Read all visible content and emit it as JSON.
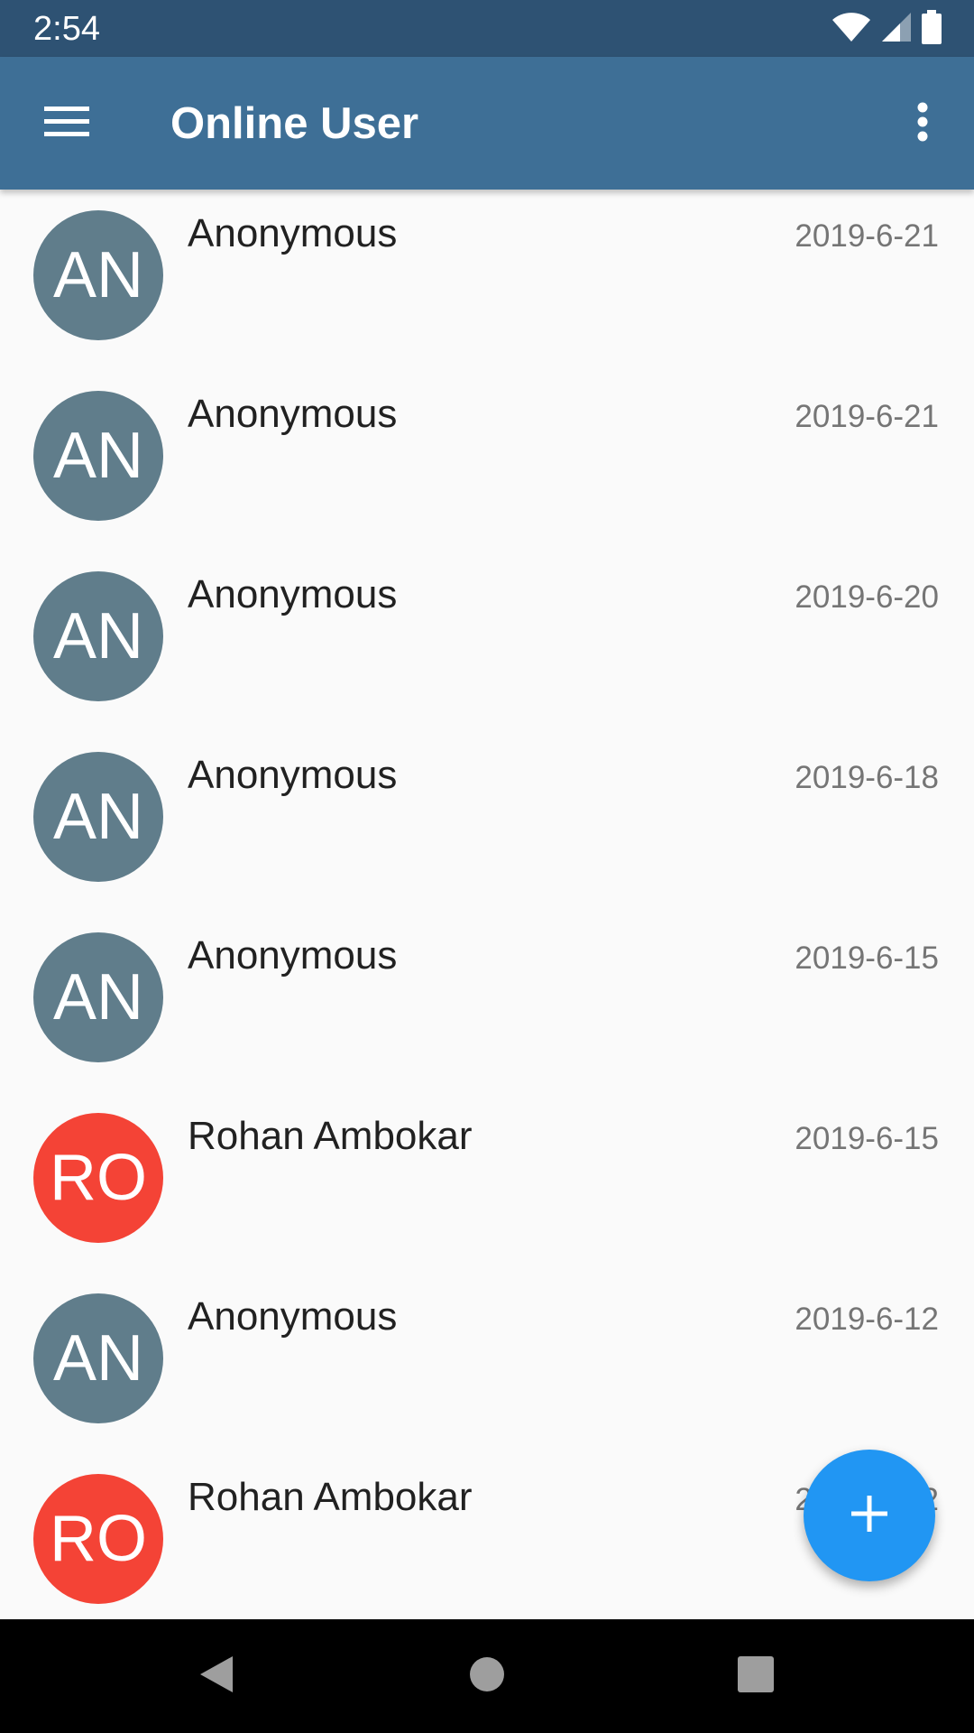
{
  "status_bar": {
    "time": "2:54",
    "icons": [
      "wifi-icon",
      "signal-icon",
      "battery-icon"
    ],
    "color": "#2e5273"
  },
  "app_bar": {
    "title": "Online User",
    "menu_icon": "menu-icon",
    "more_icon": "more-vert-icon",
    "color": "#3e6f96"
  },
  "users": [
    {
      "initials": "AN",
      "name": "Anonymous",
      "date": "2019-6-21",
      "color": "#607d8b"
    },
    {
      "initials": "AN",
      "name": "Anonymous",
      "date": "2019-6-21",
      "color": "#607d8b"
    },
    {
      "initials": "AN",
      "name": "Anonymous",
      "date": "2019-6-20",
      "color": "#607d8b"
    },
    {
      "initials": "AN",
      "name": "Anonymous",
      "date": "2019-6-18",
      "color": "#607d8b"
    },
    {
      "initials": "AN",
      "name": "Anonymous",
      "date": "2019-6-15",
      "color": "#607d8b"
    },
    {
      "initials": "RO",
      "name": "Rohan Ambokar",
      "date": "2019-6-15",
      "color": "#f44336"
    },
    {
      "initials": "AN",
      "name": "Anonymous",
      "date": "2019-6-12",
      "color": "#607d8b"
    },
    {
      "initials": "RO",
      "name": "Rohan Ambokar",
      "date": "2019-6-12",
      "color": "#f44336"
    }
  ],
  "fab": {
    "icon": "add-icon",
    "color": "#2196f3"
  },
  "nav_bar": {
    "icons": [
      "back-icon",
      "home-icon",
      "recents-icon"
    ]
  }
}
